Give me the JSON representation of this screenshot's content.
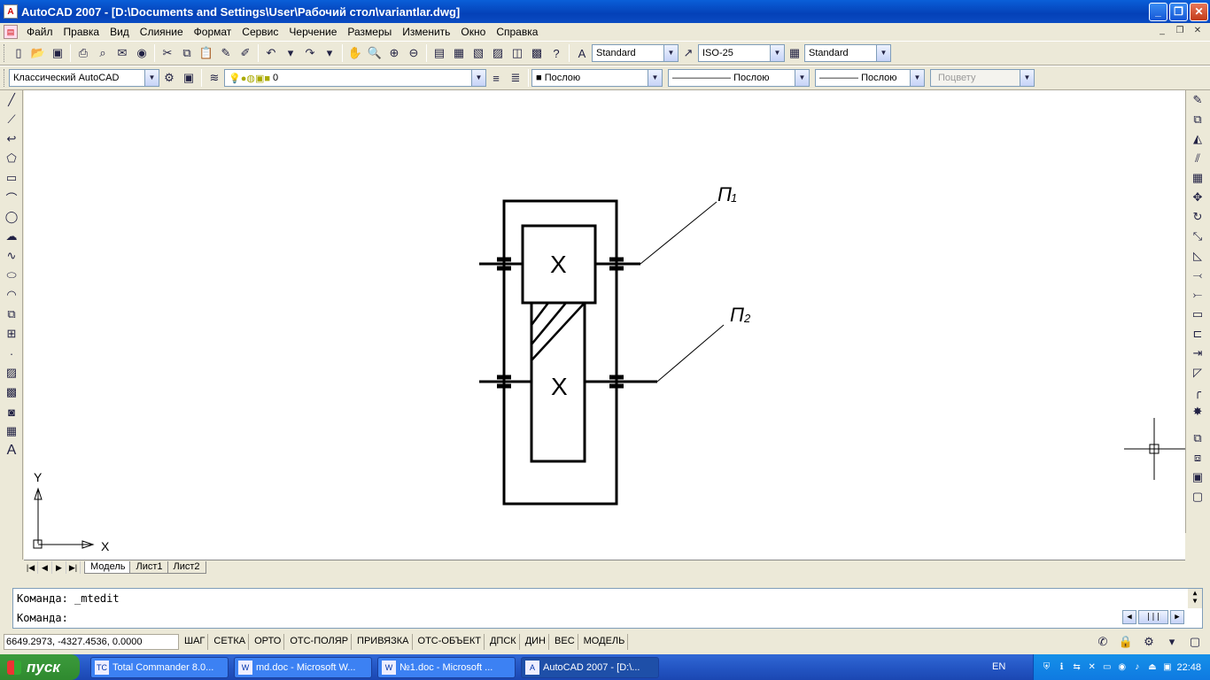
{
  "window": {
    "title": "AutoCAD 2007 - [D:\\Documents and Settings\\User\\Рабочий стол\\variantlar.dwg]",
    "app_icon": "autocad-icon",
    "btn_min": "_",
    "btn_max": "❐",
    "btn_close": "✕"
  },
  "menu": {
    "items": [
      "Файл",
      "Правка",
      "Вид",
      "Слияние",
      "Формат",
      "Сервис",
      "Черчение",
      "Размеры",
      "Изменить",
      "Окно",
      "Справка"
    ],
    "mdi_min": "_",
    "mdi_restore": "❐",
    "mdi_close": "✕"
  },
  "toolbar1": {
    "text_style": "Standard",
    "dim_style": "ISO-25",
    "table_style": "Standard"
  },
  "toolbar2": {
    "workspace": "Классический AutoCAD",
    "layer": "0",
    "color": "Послою",
    "linetype": "Послою",
    "lineweight": "Послою",
    "plotstyle": "Поцвету"
  },
  "drawing": {
    "label_x": "X",
    "label_x2": "X",
    "shaft1": "П",
    "shaft1_sub": "1",
    "shaft2": "П",
    "shaft2_sub": "2",
    "ucs_x": "X",
    "ucs_y": "Y"
  },
  "tabs": {
    "model": "Модель",
    "sheet1": "Лист1",
    "sheet2": "Лист2"
  },
  "command": {
    "history": "Команда:  _mtedit",
    "prompt": "Команда:"
  },
  "status": {
    "coords": "6649.2973, -4327.4536, 0.0000",
    "buttons": [
      "ШАГ",
      "СЕТКА",
      "ОРТО",
      "ОТС-ПОЛЯР",
      "ПРИВЯЗКА",
      "ОТС-ОБЪЕКТ",
      "ДПСК",
      "ДИН",
      "ВЕС",
      "МОДЕЛЬ"
    ]
  },
  "taskbar": {
    "start": "пуск",
    "tasks": [
      "Total Commander 8.0...",
      "md.doc - Microsoft W...",
      "№1.doc - Microsoft ...",
      "AutoCAD 2007 - [D:\\..."
    ],
    "lang": "EN",
    "clock": "22:48"
  }
}
